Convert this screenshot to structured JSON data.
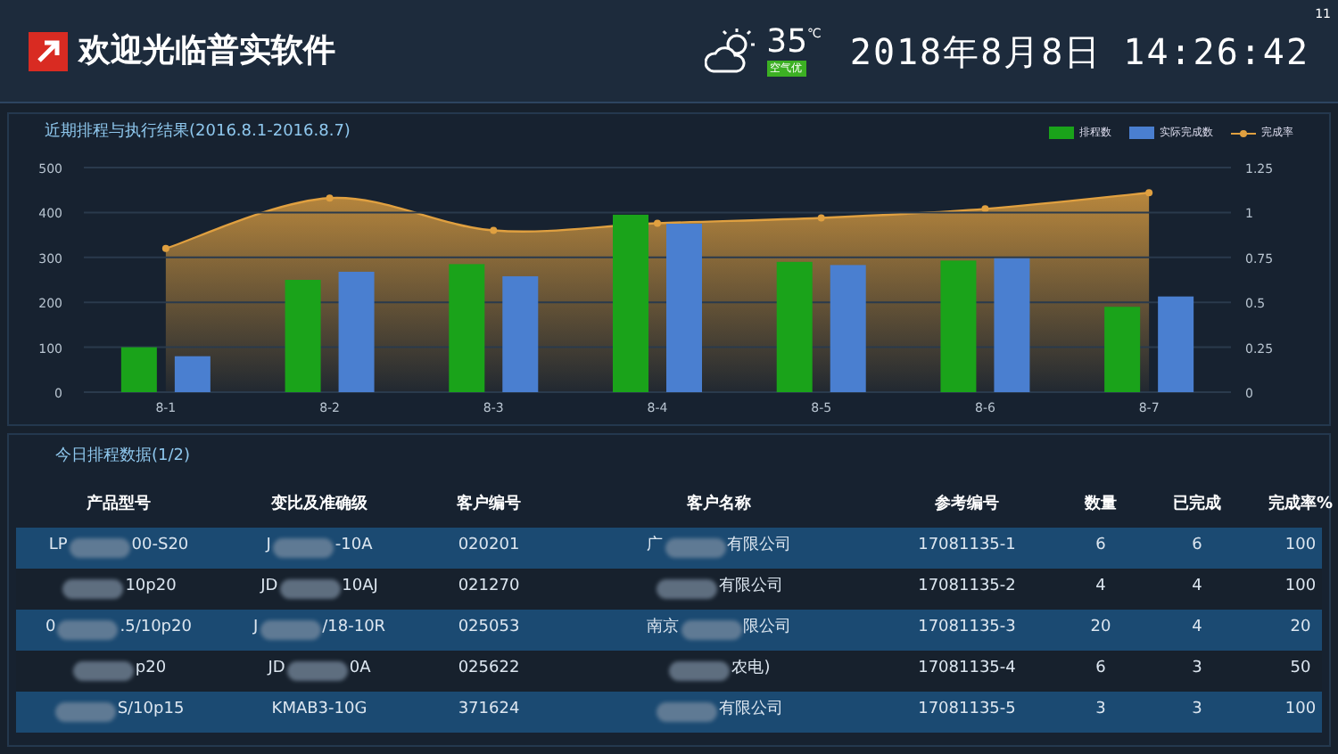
{
  "header": {
    "title": "欢迎光临普实软件",
    "temperature": "35",
    "unit": "℃",
    "air_quality": "空气优",
    "date": "2018年8月8日",
    "time": "14:26:42",
    "corner": "11"
  },
  "chart_panel": {
    "title": "近期排程与执行结果(2016.8.1-2016.8.7)",
    "bar_chart": {
      "chart_data": {
        "type": "bar",
        "grid": true,
        "categories": [
          "8-1",
          "8-2",
          "8-3",
          "8-4",
          "8-5",
          "8-6",
          "8-7"
        ],
        "ylim": [
          0,
          500
        ],
        "yticks": [
          0,
          100,
          200,
          300,
          400,
          500
        ],
        "series": [
          {
            "name": "排程数",
            "color": "#1aa31a",
            "values": [
              100,
              250,
              285,
              395,
              290,
              293,
              190
            ]
          },
          {
            "name": "实际完成数",
            "color": "#4a7fd0",
            "values": [
              80,
              268,
              258,
              375,
              283,
              298,
              213
            ]
          }
        ]
      }
    },
    "rate_chart": {
      "chart_data": {
        "type": "area",
        "ylim": [
          0,
          1.25
        ],
        "yticks": [
          {
            "value": 0,
            "label": "0"
          },
          {
            "value": 0.25,
            "label": "0.25"
          },
          {
            "value": 0.5,
            "label": "0.5"
          },
          {
            "value": 0.75,
            "label": "0.75"
          },
          {
            "value": 1,
            "label": "1"
          },
          {
            "value": 1.25,
            "label": "1.25"
          }
        ],
        "series": [
          {
            "name": "完成率",
            "color": "#e0a040",
            "values": [
              0.8,
              1.08,
              0.9,
              0.94,
              0.97,
              1.02,
              1.11
            ]
          }
        ]
      }
    }
  },
  "table_panel": {
    "title": "今日排程数据(1/2)",
    "columns": [
      "产品型号",
      "变比及准确级",
      "客户编号",
      "客户名称",
      "参考编号",
      "数量",
      "已完成",
      "完成率%"
    ],
    "rows": [
      [
        {
          "before": "LP",
          "after": "00-S20"
        },
        {
          "before": "J",
          "after": "-10A"
        },
        {
          "text": "020201"
        },
        {
          "before": "广",
          "after": "有限公司"
        },
        {
          "text": "17081135-1"
        },
        {
          "text": "6"
        },
        {
          "text": "6"
        },
        {
          "text": "100"
        }
      ],
      [
        {
          "after": "10p20"
        },
        {
          "before": "JD",
          "after": "10AJ"
        },
        {
          "text": "021270"
        },
        {
          "after": "有限公司"
        },
        {
          "text": "17081135-2"
        },
        {
          "text": "4"
        },
        {
          "text": "4"
        },
        {
          "text": "100"
        }
      ],
      [
        {
          "before": "0",
          "after": ".5/10p20"
        },
        {
          "before": "J",
          "after": "/18-10R"
        },
        {
          "text": "025053"
        },
        {
          "before": "南京",
          "after": "限公司"
        },
        {
          "text": "17081135-3"
        },
        {
          "text": "20"
        },
        {
          "text": "4"
        },
        {
          "text": "20"
        }
      ],
      [
        {
          "after": "p20"
        },
        {
          "before": "JD",
          "after": "0A"
        },
        {
          "text": "025622"
        },
        {
          "after": "农电)"
        },
        {
          "text": "17081135-4"
        },
        {
          "text": "6"
        },
        {
          "text": "3"
        },
        {
          "text": "50"
        }
      ],
      [
        {
          "after": "S/10p15"
        },
        {
          "text": "KMAB3-10G"
        },
        {
          "text": "371624"
        },
        {
          "after": "有限公司"
        },
        {
          "text": "17081135-5"
        },
        {
          "text": "3"
        },
        {
          "text": "3"
        },
        {
          "text": "100"
        }
      ]
    ]
  }
}
